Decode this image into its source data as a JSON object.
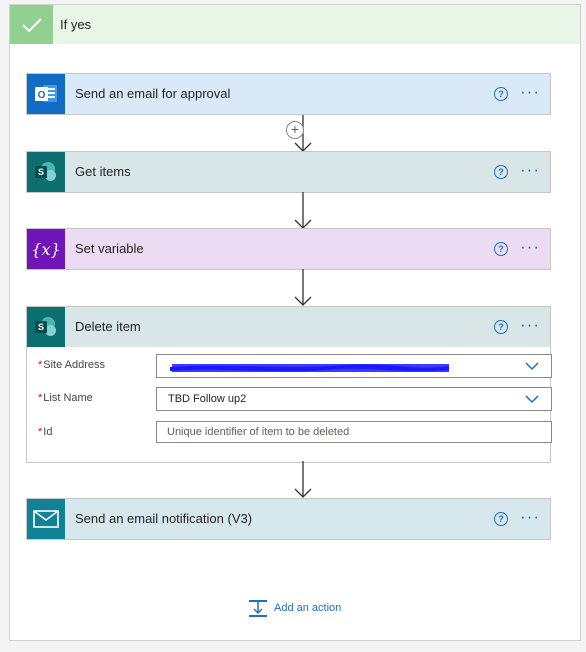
{
  "condition": {
    "title": "If yes"
  },
  "actions": {
    "email_approval": {
      "title": "Send an email for approval",
      "help": "?",
      "more": "···"
    },
    "get_items": {
      "title": "Get items",
      "help": "?",
      "more": "···"
    },
    "set_variable": {
      "title": "Set variable",
      "help": "?",
      "more": "···",
      "icon_text": "{x}"
    },
    "delete_item": {
      "title": "Delete item",
      "help": "?",
      "more": "···",
      "fields": {
        "site_address": {
          "label": "Site Address",
          "required_mark": "*",
          "value": ""
        },
        "list_name": {
          "label": "List Name",
          "required_mark": "*",
          "value": "TBD Follow up2"
        },
        "id": {
          "label": "Id",
          "required_mark": "*",
          "placeholder": "Unique identifier of item to be deleted"
        }
      }
    },
    "email_notification": {
      "title": "Send an email notification (V3)",
      "help": "?",
      "more": "···"
    }
  },
  "insert_step": {
    "symbol": "+"
  },
  "add_action": {
    "label": "Add an action"
  },
  "colors": {
    "accent_blue": "#1f6fc5",
    "outlook": "#0f6bc4",
    "sharepoint": "#0d6f6f",
    "variable": "#7016b8",
    "mail": "#0f8298",
    "condition_green": "#92d092",
    "redaction": "#1a1aff"
  },
  "icons": [
    "check-icon",
    "outlook-icon",
    "sharepoint-icon",
    "variable-icon",
    "mail-icon",
    "help-icon",
    "more-icon",
    "chevron-down-icon",
    "plus-icon",
    "add-action-icon",
    "arrow-down-icon"
  ]
}
